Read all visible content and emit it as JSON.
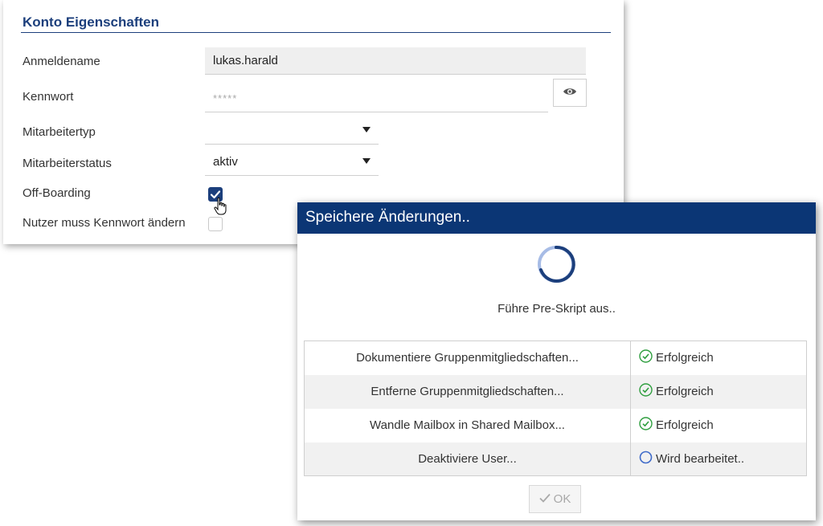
{
  "account_panel": {
    "title": "Konto Eigenschaften",
    "fields": {
      "login_name": {
        "label": "Anmeldename",
        "value": "lukas.harald"
      },
      "password": {
        "label": "Kennwort",
        "placeholder": "*****"
      },
      "employee_type": {
        "label": "Mitarbeitertyp",
        "value": ""
      },
      "employee_status": {
        "label": "Mitarbeiterstatus",
        "value": "aktiv"
      },
      "offboarding": {
        "label": "Off-Boarding",
        "checked": true
      },
      "must_change_password": {
        "label": "Nutzer muss Kennwort ändern",
        "checked": false
      }
    },
    "icons": {
      "show_password": "eye-icon",
      "cursor": "hand-pointer-icon"
    },
    "colors": {
      "accent": "#1c3f7c"
    }
  },
  "progress_dialog": {
    "title": "Speichere Änderungen..",
    "status_text": "Führe Pre-Skript aus..",
    "steps": [
      {
        "name": "Dokumentiere Gruppenmitgliedschaften...",
        "status": "Erfolgreich",
        "state": "success"
      },
      {
        "name": "Entferne Gruppenmitgliedschaften...",
        "status": "Erfolgreich",
        "state": "success"
      },
      {
        "name": "Wandle Mailbox in Shared Mailbox...",
        "status": "Erfolgreich",
        "state": "success"
      },
      {
        "name": "Deaktiviere User...",
        "status": "Wird bearbeitet..",
        "state": "in-progress"
      }
    ],
    "ok_button": {
      "label": "OK",
      "disabled": true
    },
    "colors": {
      "header": "#0b3675",
      "success": "#2e9e3e",
      "in_progress": "#3f6bc9"
    }
  }
}
